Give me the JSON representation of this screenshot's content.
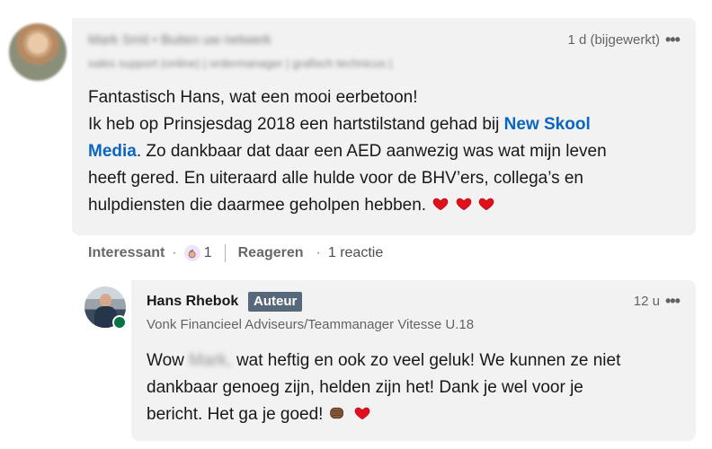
{
  "comment": {
    "author_name": "Mark Smit",
    "author_degree": "• Buiten uw netwerk",
    "author_headline": "sales support (online) | ordermanager | grafisch technicus |",
    "timestamp": "1 d (bijgewerkt)",
    "line1": "Fantastisch Hans, wat een mooi eerbetoon!",
    "line2_prefix": "Ik heb op Prinsjesdag 2018 een hartstilstand gehad bij ",
    "mention_part1": "New Skool",
    "mention_part2": "Media",
    "line3_suffix": ". Zo dankbaar dat daar een AED aanwezig was wat mijn leven",
    "line4": "heeft gered. En uiteraard alle hulde voor de BHV’ers, collega’s en",
    "line5": "hulpdiensten die daarmee geholpen hebben.",
    "emoji_icons": [
      "red-heart-icon",
      "red-heart-icon",
      "red-heart-icon"
    ]
  },
  "actions": {
    "react_label": "Interessant",
    "reaction_icon": "clapping-reaction-icon",
    "reaction_count": "1",
    "reply_label": "Reageren",
    "reply_count": "1 reactie"
  },
  "reply": {
    "author_name": "Hans Rhebok",
    "badge": "Auteur",
    "headline": "Vonk Financieel Adviseurs/Teammanager Vitesse U.18",
    "timestamp": "12 u",
    "text_line1_prefix": "Wow ",
    "text_line1_blurred": "Mark,",
    "text_line1_suffix": " wat heftig en ook zo veel geluk! We kunnen ze niet",
    "text_line2": "dankbaar genoeg zijn, helden zijn het! Dank je wel voor je",
    "text_line3": "bericht. Het ga je goed!",
    "emoji_icons": [
      "fist-bump-icon",
      "red-heart-icon"
    ]
  },
  "colors": {
    "bubble_bg": "#f2f2f2",
    "link_blue": "#0a66c2",
    "badge_bg": "#56687a",
    "online_green": "#057642",
    "heart_red": "#e0111b"
  }
}
